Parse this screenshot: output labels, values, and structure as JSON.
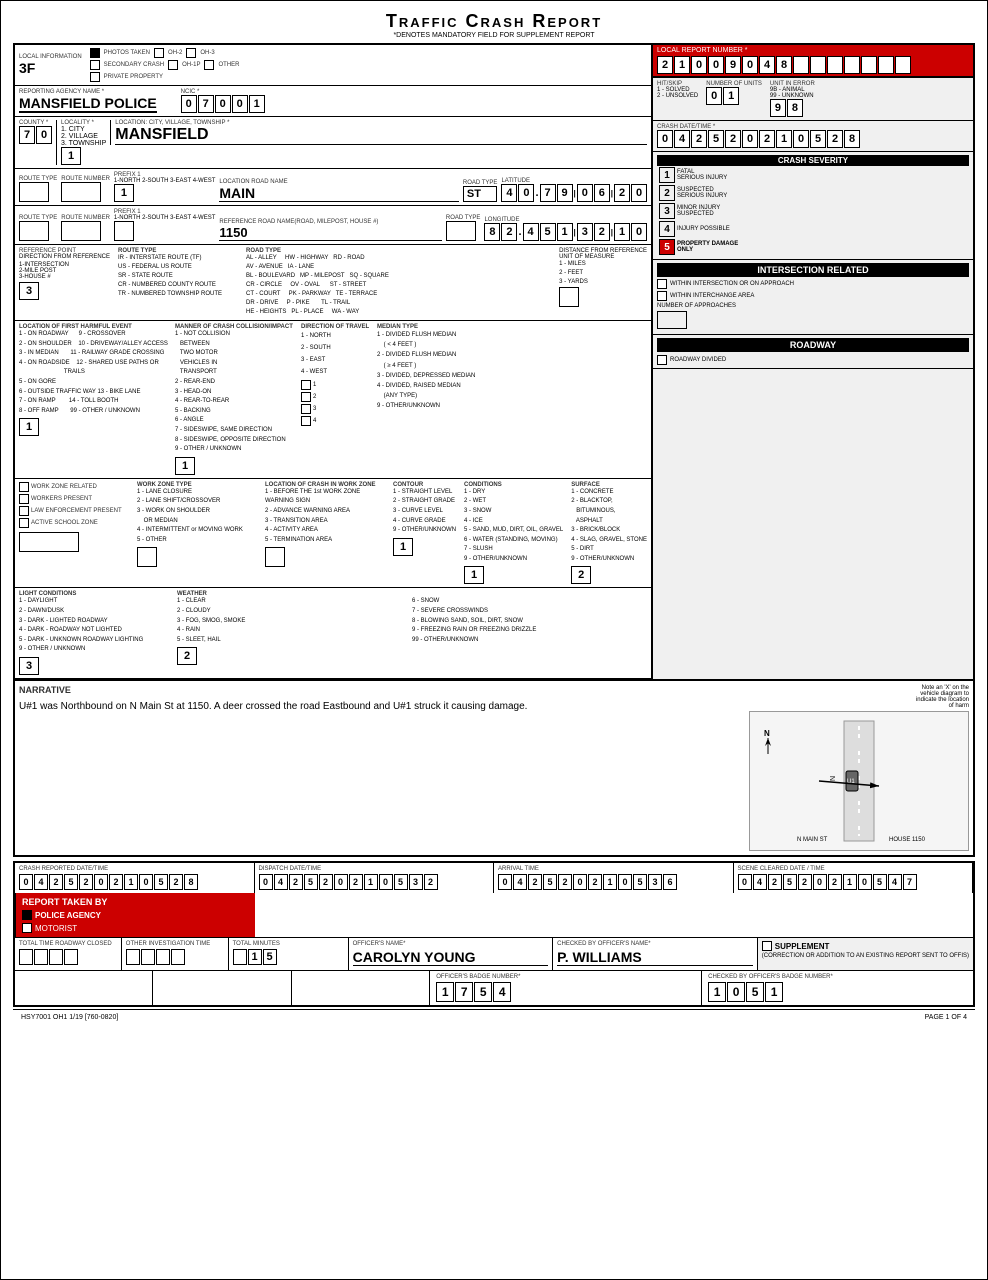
{
  "title": "Traffic Crash Report",
  "subtitle": "*DENOTES MANDATORY FIELD FOR SUPPLEMENT REPORT",
  "header": {
    "localInfo": "LOCAL INFORMATION",
    "localInfoValue": "3F",
    "photos": "PHOTOS TAKEN",
    "oh2": "OH-2",
    "oh3": "OH-3",
    "secondaryCrash": "SECONDARY CRASH",
    "oh1p": "OH-1P",
    "other": "OTHER",
    "privateProperty": "PRIVATE PROPERTY"
  },
  "reportNumber": {
    "label": "LOCAL REPORT NUMBER *",
    "chars": [
      "2",
      "1",
      "0",
      "0",
      "9",
      "0",
      "4",
      "8",
      "",
      "",
      "",
      "",
      "",
      "",
      ""
    ]
  },
  "reportingAgency": {
    "label": "REPORTING AGENCY NAME *",
    "value": "MANSFIELD POLICE",
    "ncic_label": "NCIC *",
    "ncic_chars": [
      "0",
      "7",
      "0",
      "0",
      "1"
    ]
  },
  "hitSkip": {
    "label": "HIT/SKIP",
    "opt1": "1 - SOLVED",
    "opt2": "2 - UNSOLVED",
    "numUnits": {
      "label": "NUMBER OF UNITS",
      "chars": [
        "0",
        "1"
      ]
    },
    "unitError": {
      "label": "UNIT IN ERROR",
      "opt1": "9B - ANIMAL",
      "opt2": "99 - UNKNOWN",
      "chars": [
        "9",
        "8"
      ]
    }
  },
  "county": {
    "label": "COUNTY *",
    "chars": [
      "7",
      "0"
    ]
  },
  "locality": {
    "label": "LOCALITY *",
    "opt1": "1. CITY",
    "opt2": "2. VILLAGE",
    "opt3": "3. TOWNSHIP",
    "value": "1"
  },
  "location": {
    "label": "LOCATION: CITY, VILLAGE, TOWNSHIP *",
    "value": "MANSFIELD"
  },
  "crashDateTime": {
    "label": "CRASH DATE/TIME *",
    "chars": [
      "0",
      "4",
      "2",
      "5",
      "2",
      "0",
      "2",
      "1",
      "0",
      "5",
      "2",
      "8"
    ]
  },
  "crashSeverity": {
    "label": "CRASH SEVERITY",
    "items": [
      {
        "num": "1",
        "text": "FATAL\nSERIOUS INJURY",
        "selected": false
      },
      {
        "num": "2",
        "text": "SUSPECTED\nSERIOUS INJURY",
        "selected": false
      },
      {
        "num": "3",
        "text": "MINOR INJURY\nSUSPECTED",
        "selected": false
      },
      {
        "num": "4",
        "text": "INJURY POSSIBLE",
        "selected": false
      },
      {
        "num": "5",
        "text": "PROPERTY DAMAGE\nONLY",
        "selected": true
      }
    ],
    "selectedNum": "5"
  },
  "routeType1": {
    "label": "ROUTE TYPE",
    "routeNum": {
      "label": "ROUTE NUMBER",
      "value": ""
    },
    "prefix1": {
      "label": "PREFIX 1",
      "opts": [
        "1 - NORTH",
        "2 - SOUTH",
        "3 - EAST",
        "4 - WEST"
      ],
      "value": "1"
    },
    "locationRoadName": {
      "label": "LOCATION ROAD NAME",
      "value": "MAIN"
    },
    "roadType": {
      "label": "ROAD TYPE",
      "value": "ST"
    },
    "latitude": {
      "label": "LATITUDE",
      "chars": [
        "4",
        "0",
        ".",
        "7",
        "9",
        "|",
        "0",
        "6",
        "|",
        "2",
        "0"
      ]
    }
  },
  "routeType2": {
    "label": "ROUTE TYPE",
    "routeNum": {
      "label": "ROUTE NUMBER"
    },
    "prefix1": {
      "label": "PREFIX 1",
      "value": ""
    },
    "refRoadName": {
      "label": "REFERENCE ROAD NAME(ROAD, MILEPOST, HOUSE #)",
      "value": "1150"
    },
    "roadType": {
      "label": "ROAD TYPE"
    },
    "longitude": {
      "label": "LONGITUDE",
      "chars": [
        "8",
        "2",
        ".",
        "4",
        "5",
        "1",
        "|",
        "3",
        "2",
        "|",
        "1",
        "0"
      ]
    }
  },
  "refPoint": {
    "label": "REFERENCE POINT",
    "dirFromRef": {
      "label": "DIRECTION FROM REFERENCE",
      "opts": [
        "1 - NORTH",
        "2 - SOUTH",
        "3 - EAST",
        "4 - WEST"
      ]
    },
    "opts": [
      "1 - INTERSECTION",
      "2 - MILE POST",
      "3 - HOUSE #"
    ],
    "value": "3"
  },
  "routeTypeSection": {
    "label": "ROUTE TYPE",
    "items": [
      "IR - INTERSTATE ROUTE (TF)",
      "US - FEDERAL US ROUTE",
      "SR - STATE ROUTE",
      "CR - NUMBERED COUNTY ROUTE",
      "TR - NUMBERED TOWNSHIP ROUTE"
    ]
  },
  "roadTypeSection": {
    "label": "ROAD TYPE",
    "items": [
      "AL - ALLEY    HW - HIGHWAY  RD - ROAD",
      "AV - AVENUE  IA - LANE",
      "BL - BOULEVARD  MP - MILEPOST  SQ - SQUARE",
      "CR - CIRCLE    OV - OVAL    ST - STREET",
      "CT - COURT    PK - PARKWAY  TE - TERRACE",
      "DR - DRIVE    P - PIKE    TL - TRAIL",
      "HE - HEIGHTS  PL - PLACE  WA - WAY"
    ]
  },
  "distance": {
    "label": "DISTANCE FROM REFERENCE",
    "unitLabel": "UNIT OF MEASURE",
    "opts": [
      "1 - MILES",
      "2 - FEET",
      "3 - YARDS"
    ],
    "value": ""
  },
  "intersectionRelated": {
    "title": "INTERSECTION RELATED",
    "withinIntersection": "WITHIN INTERSECTION OR ON APPROACH",
    "withinInterchange": "WITHIN INTERCHANGE AREA",
    "numApproaches": "NUMBER OF APPROACHES"
  },
  "roadway": {
    "title": "ROADWAY",
    "roadwayDivided": "ROADWAY DIVIDED"
  },
  "location1stHarmful": {
    "label": "LOCATION OF FIRST HARMFUL EVENT",
    "items": [
      "1 - ON ROADWAY",
      "9 - CROSSOVER",
      "2 - ON SHOULDER",
      "10 - DRIVEWAY/ALLEY ACCESS",
      "3 - IN MEDIAN",
      "11 - RAILWAY GRADE CROSSING",
      "4 - ON ROADSIDE",
      "12 - SHARED USE PATHS OR TRAILS",
      "5 - ON GORE",
      "",
      "6 - OUTSIDE TRAFFIC WAY",
      "13 - BIKE LANE",
      "7 - ON RAMP",
      "14 - TOLL BOOTH",
      "8 - OFF RAMP",
      "99 - OTHER / UNKNOWN"
    ],
    "value": "1"
  },
  "mannerOfCrash": {
    "label": "MANNER OF CRASH COLLISION/IMPACT",
    "items": [
      "1 - NOT COLLISION BETWEEN TWO MOTOR VEHICLES IN TRANSPORT",
      "2 - REAR-END",
      "3 - HEAD-ON",
      "4 - REAR-TO-REAR",
      "5 - BACKING",
      "6 - ANGLE",
      "7 - SIDESWIPE, SAME DIRECTION",
      "8 - SIDESWIPE, OPPOSITE DIRECTION",
      "9 - OTHER / UNKNOWN"
    ],
    "value": "1"
  },
  "directionTravel": {
    "label": "DIRECTION OF TRAVEL",
    "opts": [
      "1 - NORTH",
      "2 - SOUTH",
      "3 - EAST",
      "4 - WEST"
    ]
  },
  "medianType": {
    "label": "MEDIAN TYPE",
    "items": [
      "1 - DIVIDED FLUSH MEDIAN (< 4 FEET)",
      "2 - DIVIDED FLUSH MEDIAN (≥ 4 FEET)",
      "3 - DIVIDED, DEPRESSED MEDIAN",
      "4 - DIVIDED, RAISED MEDIAN (ANY TYPE)",
      "9 - OTHER/UNKNOWN"
    ]
  },
  "workZone": {
    "label": "WORK ZONE RELATED",
    "workersPresent": "WORKERS PRESENT",
    "lawEnforcement": "LAW ENFORCEMENT PRESENT",
    "activeSchool": "ACTIVE SCHOOL ZONE",
    "workZoneType": {
      "label": "WORK ZONE TYPE",
      "items": [
        "1 - LANE CLOSURE",
        "2 - LANE SHIFT/CROSSOVER",
        "3 - WORK ON SHOULDER OR MEDIAN",
        "4 - INTERMITTENT or MOVING WORK",
        "5 - OTHER"
      ]
    },
    "locationInWorkZone": {
      "label": "LOCATION OF CRASH IN WORK ZONE",
      "items": [
        "1 - BEFORE THE 1st WORK ZONE WARNING SIGN",
        "2 - ADVANCE WARNING AREA",
        "3 - TRANSITION AREA",
        "4 - ACTIVITY AREA",
        "5 - TERMINATION AREA"
      ]
    }
  },
  "contour": {
    "label": "CONTOUR",
    "value": "1",
    "items": [
      "1 - STRAIGHT LEVEL",
      "2 - STRAIGHT GRADE",
      "3 - CURVE LEVEL",
      "4 - CURVE GRADE",
      "9 - OTHER/UNKNOWN"
    ]
  },
  "conditions": {
    "label": "CONDITIONS",
    "value": "1",
    "items": [
      "1 - DRY",
      "2 - WET",
      "3 - SNOW",
      "4 - ICE",
      "5 - SAND, MUD, DIRT, OIL, GRAVEL",
      "6 - WATER (STANDING, MOVING)",
      "7 - SLUSH",
      "9 - OTHER/UNKNOWN"
    ]
  },
  "surface": {
    "label": "SURFACE",
    "value": "2",
    "items": [
      "1 - CONCRETE",
      "2 - BLACKTOP, BITUMINOUS, ASPHALT",
      "3 - BRICK/BLOCK",
      "4 - SLAG, GRAVEL, STONE",
      "5 - DIRT",
      "9 - OTHER/UNKNOWN"
    ]
  },
  "lightConditions": {
    "label": "LIGHT CONDITIONS",
    "items": [
      "1 - DAYLIGHT",
      "2 - DAWN/DUSK",
      "3 - DARK - LIGHTED ROADWAY",
      "4 - DARK - ROADWAY NOT LIGHTED",
      "5 - DARK - UNKNOWN ROADWAY LIGHTING",
      "9 - OTHER / UNKNOWN"
    ],
    "value": "3"
  },
  "weather": {
    "label": "WEATHER",
    "items": [
      "1 - CLEAR",
      "6 - SNOW",
      "2 - CLOUDY",
      "7 - SEVERE CROSSWINDS",
      "3 - FOG, SMOG, SMOKE",
      "8 - BLOWING SAND, SOIL, DIRT, SNOW",
      "4 - RAIN",
      "9 - FREEZING RAIN OR FREEZING DRIZZLE",
      "5 - SLEET, HAIL",
      "99 - OTHER/UNKNOWN"
    ],
    "value": "2"
  },
  "narrative": {
    "label": "NARRATIVE",
    "text": "U#1 was Northbound on N Main St at 1150.  A deer crossed\nthe road Eastbound and U#1 struck it causing damage."
  },
  "crashReported": {
    "label": "CRASH REPORTED DATE/TIME",
    "chars": [
      "0",
      "4",
      "2",
      "5",
      "2",
      "0",
      "2",
      "1",
      "0",
      "5",
      "2",
      "8"
    ]
  },
  "dispatch": {
    "label": "DISPATCH DATE/TIME",
    "chars": [
      "0",
      "4",
      "2",
      "5",
      "2",
      "0",
      "2",
      "1",
      "0",
      "5",
      "3",
      "2"
    ]
  },
  "arrival": {
    "label": "ARRIVAL TIME",
    "chars": [
      "0",
      "4",
      "2",
      "5",
      "2",
      "0",
      "2",
      "1",
      "0",
      "5",
      "3",
      "6"
    ]
  },
  "sceneCleared": {
    "label": "SCENE CLEARED DATE / TIME",
    "chars": [
      "0",
      "4",
      "2",
      "5",
      "2",
      "0",
      "2",
      "1",
      "0",
      "5",
      "4",
      "7"
    ]
  },
  "reportTaken": {
    "label": "REPORT TAKEN BY",
    "policeAgency": "POLICE AGENCY",
    "motorist": "MOTORIST"
  },
  "totalTime": {
    "roadwayClosed": "TOTAL TIME ROADWAY CLOSED",
    "other": "OTHER INVESTIGATION TIME",
    "totalMinutes": "TOTAL MINUTES",
    "value": ""
  },
  "officerName": {
    "label": "OFFICER'S NAME*",
    "value": "CAROLYN YOUNG"
  },
  "checkedBy": {
    "label": "CHECKED BY OFFICER'S NAME*",
    "value": "P. WILLIAMS"
  },
  "badgeNumber": {
    "label": "OFFICER'S BADGE NUMBER*",
    "chars": [
      "1",
      "7",
      "5",
      "4"
    ]
  },
  "checkedBadge": {
    "label": "CHECKED BY OFFICER'S BADGE NUMBER*",
    "chars": [
      "1",
      "0",
      "5",
      "1"
    ]
  },
  "supplement": {
    "label": "SUPPLEMENT",
    "desc": "(CORRECTION OR ADDITION TO AN EXISTING REPORT SENT TO OFFIS)"
  },
  "totalMinutesValue": "15",
  "footer": {
    "formNum": "HSY7001 OH1 1/19 [760-0820]",
    "page": "PAGE",
    "pageNum": "1",
    "pageOf": "OF",
    "pageTotal": "4"
  }
}
